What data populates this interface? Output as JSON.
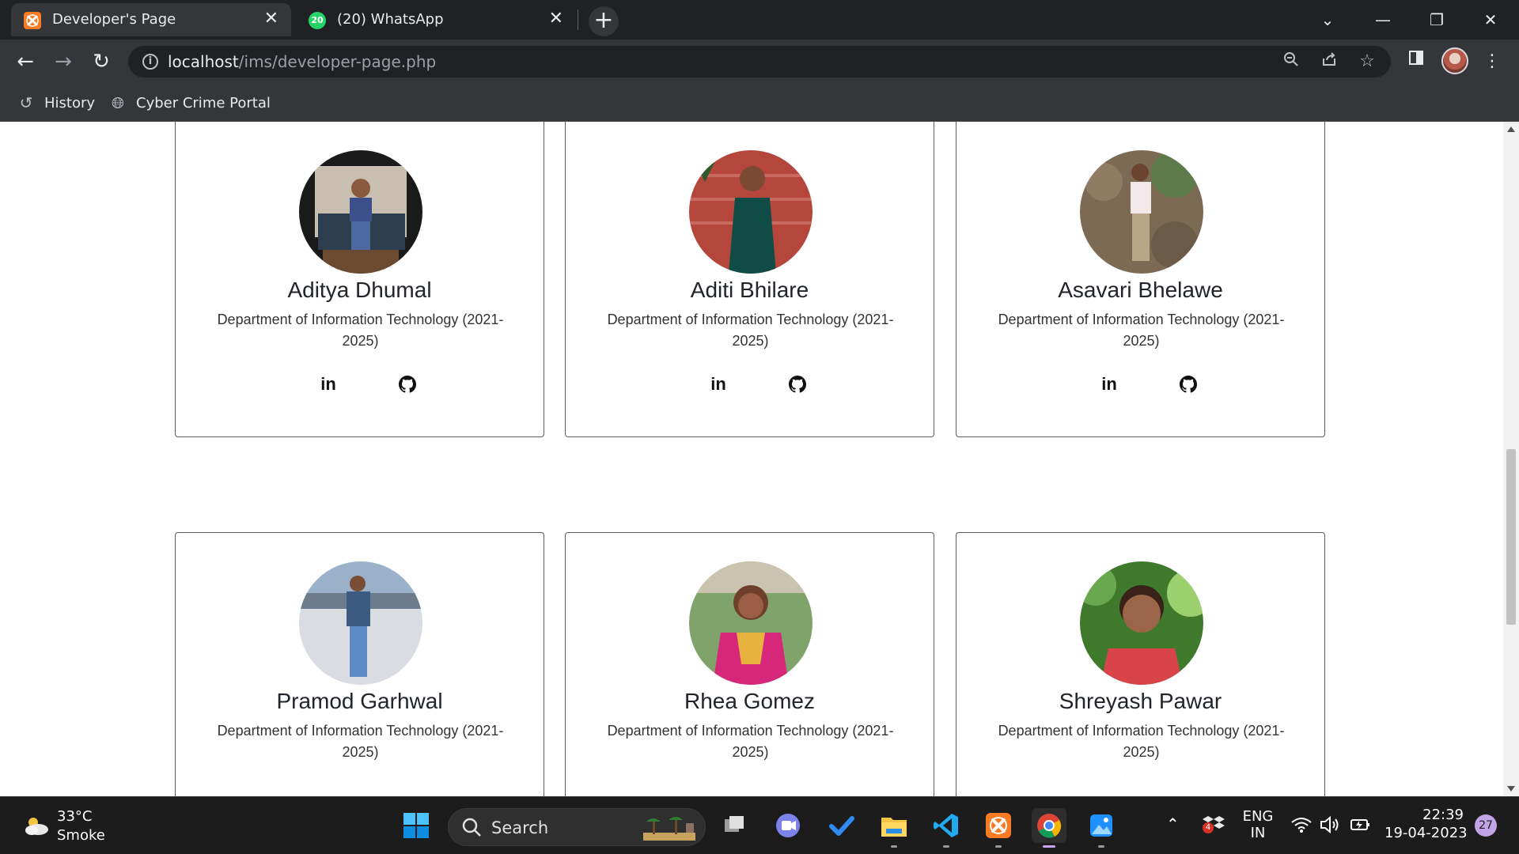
{
  "browser": {
    "tabs": [
      {
        "title": "Developer's Page",
        "active": true,
        "icon": "xampp-icon"
      },
      {
        "title": "(20) WhatsApp",
        "active": false,
        "icon": "whatsapp-icon",
        "badge": "20"
      }
    ],
    "new_tab_label": "+",
    "address_bar": {
      "host": "localhost",
      "path": "/ims/developer-page.php"
    },
    "bookmarks": [
      {
        "label": "History",
        "icon": "history-icon"
      },
      {
        "label": "Cyber Crime Portal",
        "icon": "globe-icon"
      }
    ]
  },
  "developers": [
    {
      "name": "Aditya Dhumal",
      "department": "Department of Information Technology (2021-2025)",
      "links": [
        "LinkedIn",
        "GitHub"
      ]
    },
    {
      "name": "Aditi Bhilare",
      "department": "Department of Information Technology (2021-2025)",
      "links": [
        "LinkedIn",
        "GitHub"
      ]
    },
    {
      "name": "Asavari Bhelawe",
      "department": "Department of Information Technology (2021-2025)",
      "links": [
        "LinkedIn",
        "GitHub"
      ]
    },
    {
      "name": "Pramod Garhwal",
      "department": "Department of Information Technology (2021-2025)"
    },
    {
      "name": "Rhea Gomez",
      "department": "Department of Information Technology (2021-2025)"
    },
    {
      "name": "Shreyash Pawar",
      "department": "Department of Information Technology (2021-2025)"
    }
  ],
  "dept_lines": {
    "line1": "Department of Information Technology (2021-",
    "line2": "2025)"
  },
  "social": {
    "linkedin_label": "in"
  },
  "taskbar": {
    "weather": {
      "temp": "33°C",
      "desc": "Smoke"
    },
    "search_placeholder": "Search",
    "tray": {
      "lang": "ENG",
      "region": "IN",
      "time": "22:39",
      "date": "19-04-2023",
      "notifications": "27",
      "security_badge": "4"
    }
  },
  "colors": {
    "chrome_dark": "#202124",
    "chrome_toolbar": "#35363a",
    "card_border": "#5c5c5c",
    "xampp": "#fb7a24",
    "whatsapp": "#25d366",
    "taskbar": "#1c1c1c"
  }
}
